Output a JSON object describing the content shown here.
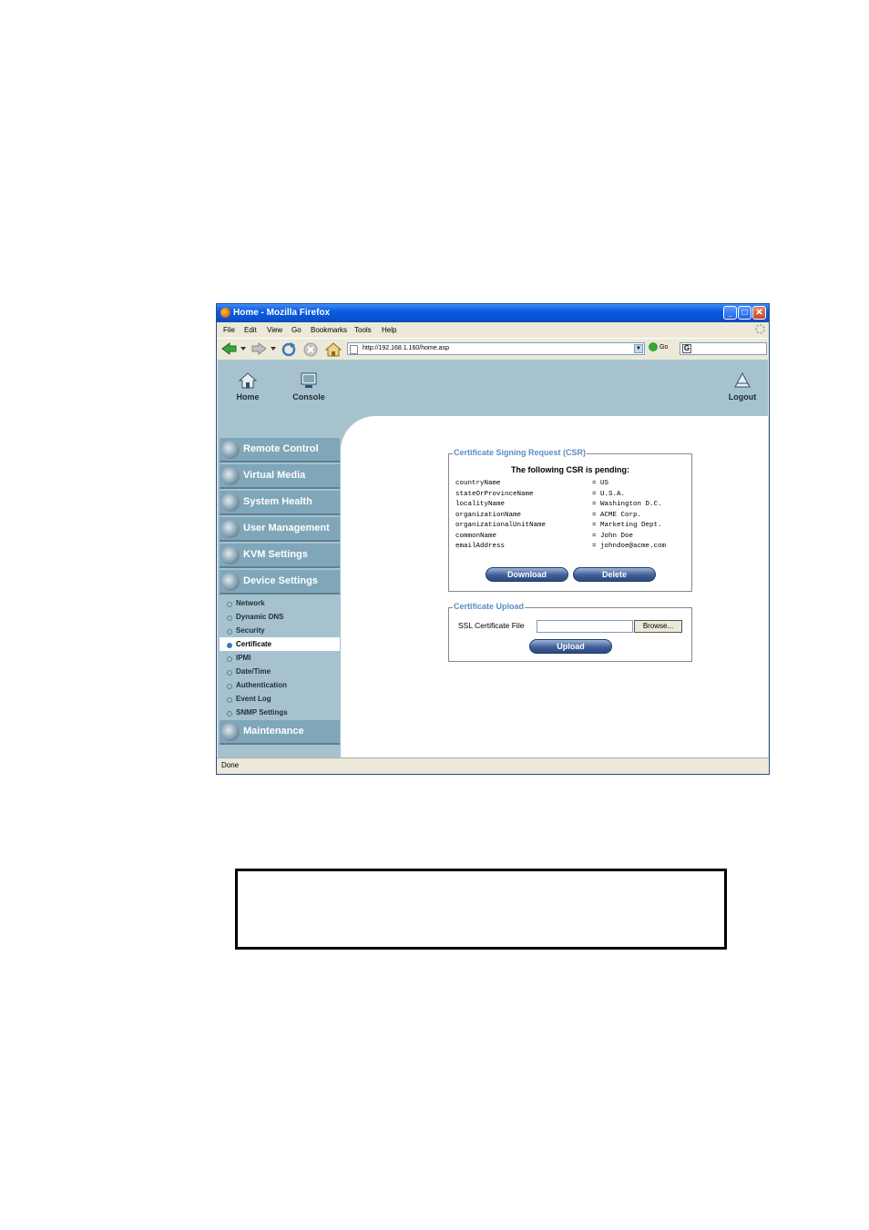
{
  "window": {
    "title": "Home - Mozilla Firefox",
    "menu": [
      "File",
      "Edit",
      "View",
      "Go",
      "Bookmarks",
      "Tools",
      "Help"
    ],
    "url": "http://192.168.1.160/home.asp",
    "go_label": "Go",
    "status": "Done"
  },
  "topnav": {
    "home": "Home",
    "console": "Console",
    "logout": "Logout"
  },
  "sidebar": {
    "sections": [
      "Remote Control",
      "Virtual Media",
      "System Health",
      "User Management",
      "KVM Settings",
      "Device Settings"
    ],
    "subitems": [
      "Network",
      "Dynamic DNS",
      "Security",
      "Certificate",
      "IPMI",
      "Date/Time",
      "Authentication",
      "Event Log",
      "SNMP Settings"
    ],
    "active_subitem": "Certificate",
    "maintenance": "Maintenance"
  },
  "csr": {
    "legend": "Certificate Signing Request (CSR)",
    "heading": "The following CSR is pending:",
    "fields": [
      {
        "key": "countryName",
        "value": "= US"
      },
      {
        "key": "stateOrProvinceName",
        "value": "= U.S.A."
      },
      {
        "key": "localityName",
        "value": "= Washington D.C."
      },
      {
        "key": "organizationName",
        "value": "= ACME Corp."
      },
      {
        "key": "organizationalUnitName",
        "value": "= Marketing Dept."
      },
      {
        "key": "commonName",
        "value": "= John Doe"
      },
      {
        "key": "emailAddress",
        "value": "= johndoe@acme.com"
      }
    ],
    "download_label": "Download",
    "delete_label": "Delete"
  },
  "upload": {
    "legend": "Certificate Upload",
    "file_label": "SSL Certificate File",
    "browse_label": "Browse...",
    "upload_label": "Upload"
  }
}
